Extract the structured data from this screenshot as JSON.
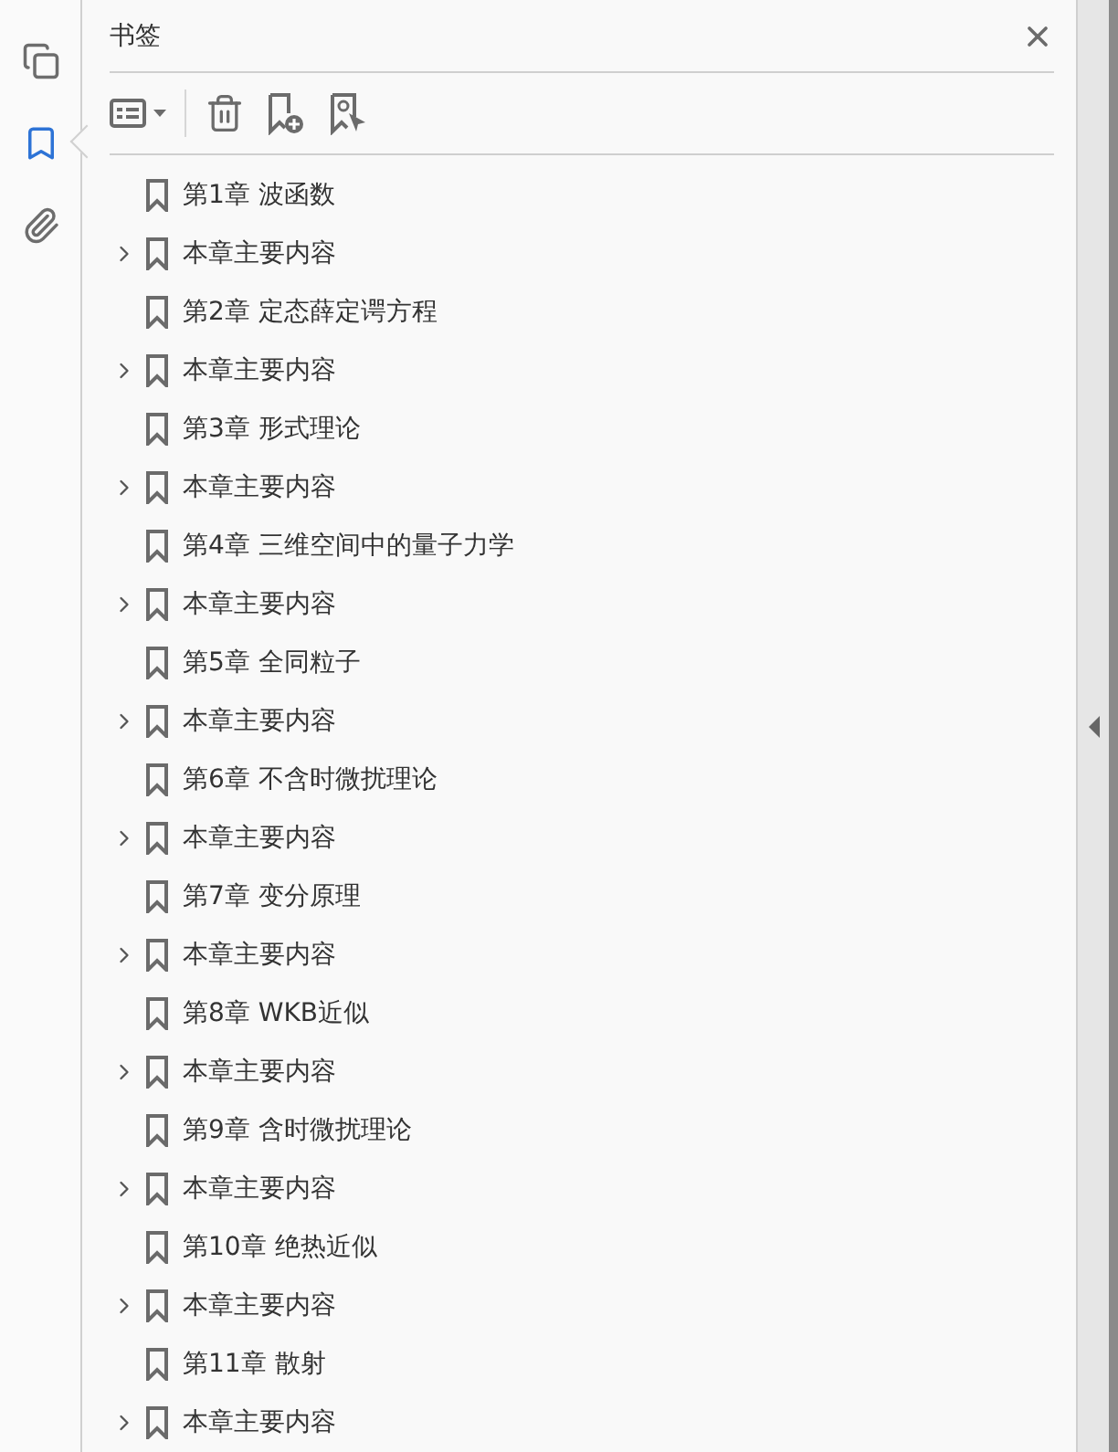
{
  "rail": [
    {
      "kind": "pages",
      "selected": false
    },
    {
      "kind": "bookmarks",
      "selected": true
    },
    {
      "kind": "attachments",
      "selected": false
    }
  ],
  "panel": {
    "title": "书签"
  },
  "bookmarks": [
    {
      "label": "第1章  波函数",
      "kind": "leaf"
    },
    {
      "label": "本章主要内容",
      "kind": "collapsed"
    },
    {
      "label": "第2章  定态薛定谔方程",
      "kind": "leaf"
    },
    {
      "label": "本章主要内容",
      "kind": "collapsed"
    },
    {
      "label": "第3章  形式理论",
      "kind": "leaf"
    },
    {
      "label": "本章主要内容",
      "kind": "collapsed"
    },
    {
      "label": "第4章  三维空间中的量子力学",
      "kind": "leaf"
    },
    {
      "label": "本章主要内容",
      "kind": "collapsed"
    },
    {
      "label": "第5章  全同粒子",
      "kind": "leaf"
    },
    {
      "label": "本章主要内容",
      "kind": "collapsed"
    },
    {
      "label": "第6章  不含时微扰理论",
      "kind": "leaf"
    },
    {
      "label": "本章主要内容",
      "kind": "collapsed"
    },
    {
      "label": "第7章  变分原理",
      "kind": "leaf"
    },
    {
      "label": "本章主要内容",
      "kind": "collapsed"
    },
    {
      "label": "第8章  WKB近似",
      "kind": "leaf"
    },
    {
      "label": "本章主要内容",
      "kind": "collapsed"
    },
    {
      "label": "第9章  含时微扰理论",
      "kind": "leaf"
    },
    {
      "label": "本章主要内容",
      "kind": "collapsed"
    },
    {
      "label": "第10章  绝热近似",
      "kind": "leaf"
    },
    {
      "label": "本章主要内容",
      "kind": "collapsed"
    },
    {
      "label": "第11章  散射",
      "kind": "leaf"
    },
    {
      "label": "本章主要内容",
      "kind": "collapsed"
    }
  ]
}
